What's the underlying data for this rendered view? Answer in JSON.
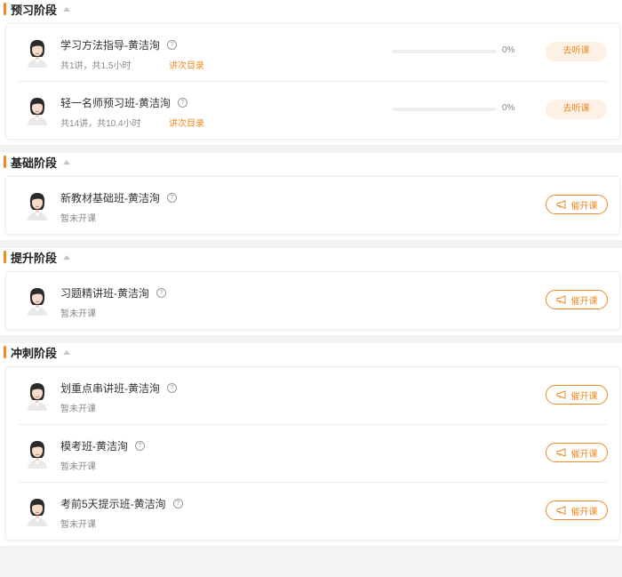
{
  "accent": "#f08a24",
  "icons": {
    "toggle": "caret-up-icon",
    "help": "question-circle-icon",
    "urge": "megaphone-icon"
  },
  "stages": [
    {
      "title": "预习阶段",
      "courses": [
        {
          "name": "学习方法指导-黄洁洵",
          "meta": "共1讲，共1.5小时",
          "catalog": "讲次目录",
          "progress": 0,
          "progress_text": "0%",
          "action": "去听课"
        },
        {
          "name": "轻一名师预习班-黄洁洵",
          "meta": "共14讲，共10.4小时",
          "catalog": "讲次目录",
          "progress": 0,
          "progress_text": "0%",
          "action": "去听课"
        }
      ]
    },
    {
      "title": "基础阶段",
      "courses": [
        {
          "name": "新教材基础班-黄洁洵",
          "meta": "暂未开课",
          "action": "催开课"
        }
      ]
    },
    {
      "title": "提升阶段",
      "courses": [
        {
          "name": "习题精讲班-黄洁洵",
          "meta": "暂未开课",
          "action": "催开课"
        }
      ]
    },
    {
      "title": "冲刺阶段",
      "courses": [
        {
          "name": "划重点串讲班-黄洁洵",
          "meta": "暂未开课",
          "action": "催开课"
        },
        {
          "name": "模考班-黄洁洵",
          "meta": "暂未开课",
          "action": "催开课"
        },
        {
          "name": "考前5天提示班-黄洁洵",
          "meta": "暂未开课",
          "action": "催开课"
        }
      ]
    }
  ]
}
